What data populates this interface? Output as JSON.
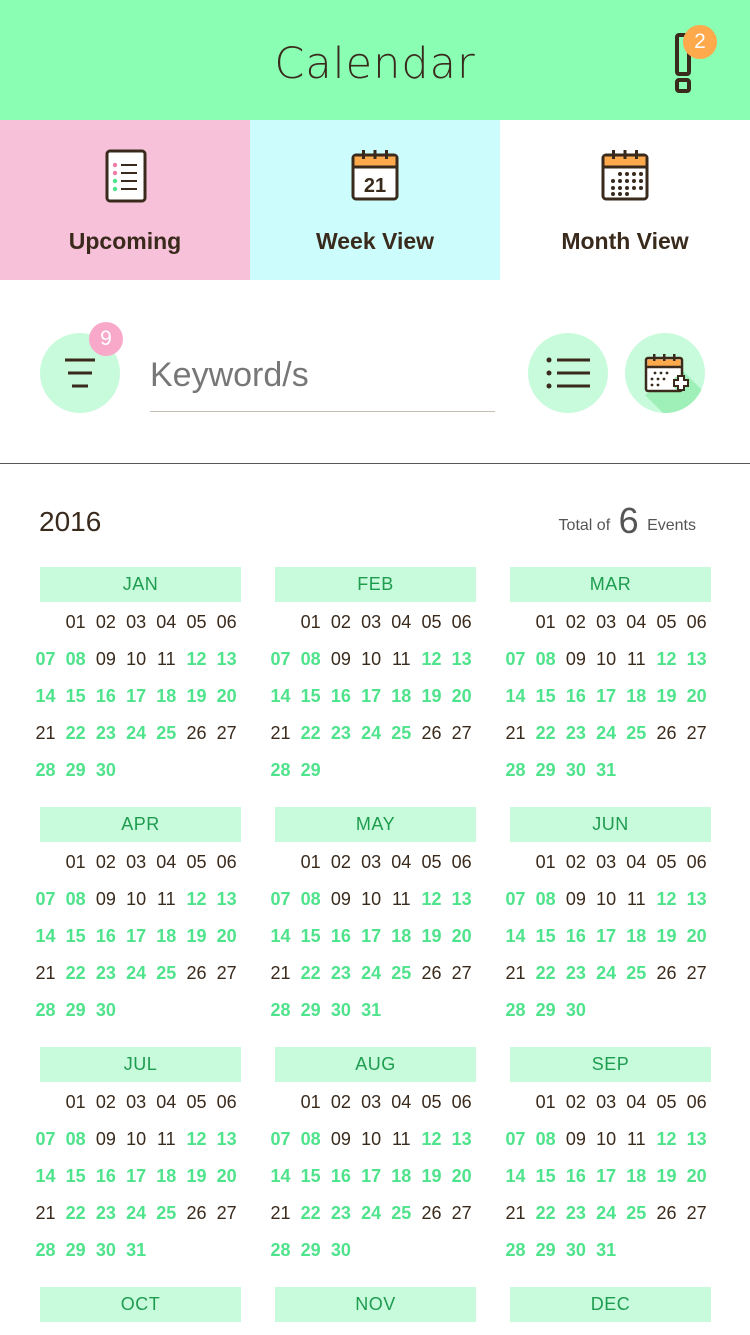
{
  "header": {
    "title": "Calendar",
    "alert_count": "2"
  },
  "tabs": [
    {
      "label": "Upcoming",
      "bg": "#f8c1da",
      "icon": "list-document-icon"
    },
    {
      "label": "Week View",
      "bg": "#ccfcfc",
      "icon": "calendar-day-icon",
      "icon_text": "21"
    },
    {
      "label": "Month View",
      "bg": "#ffffff",
      "icon": "calendar-month-icon"
    }
  ],
  "search": {
    "placeholder": "Keyword/s",
    "value": "",
    "filter_count": "9"
  },
  "summary": {
    "year": "2016",
    "total_prefix": "Total of",
    "total_count": "6",
    "total_suffix": "Events"
  },
  "colors": {
    "accent": "#8affb4",
    "month_header": "#c8fbdc",
    "weekend": "#4fe38c",
    "badge_orange": "#ffa94d",
    "badge_pink": "#f8a9c9"
  },
  "months": [
    {
      "name": "JAN",
      "days": 30,
      "offset": 1
    },
    {
      "name": "FEB",
      "days": 29,
      "offset": 1
    },
    {
      "name": "MAR",
      "days": 31,
      "offset": 1
    },
    {
      "name": "APR",
      "days": 30,
      "offset": 1
    },
    {
      "name": "MAY",
      "days": 31,
      "offset": 1
    },
    {
      "name": "JUN",
      "days": 30,
      "offset": 1
    },
    {
      "name": "JUL",
      "days": 31,
      "offset": 1
    },
    {
      "name": "AUG",
      "days": 30,
      "offset": 1
    },
    {
      "name": "SEP",
      "days": 31,
      "offset": 1
    },
    {
      "name": "OCT"
    },
    {
      "name": "NOV"
    },
    {
      "name": "DEC"
    }
  ]
}
